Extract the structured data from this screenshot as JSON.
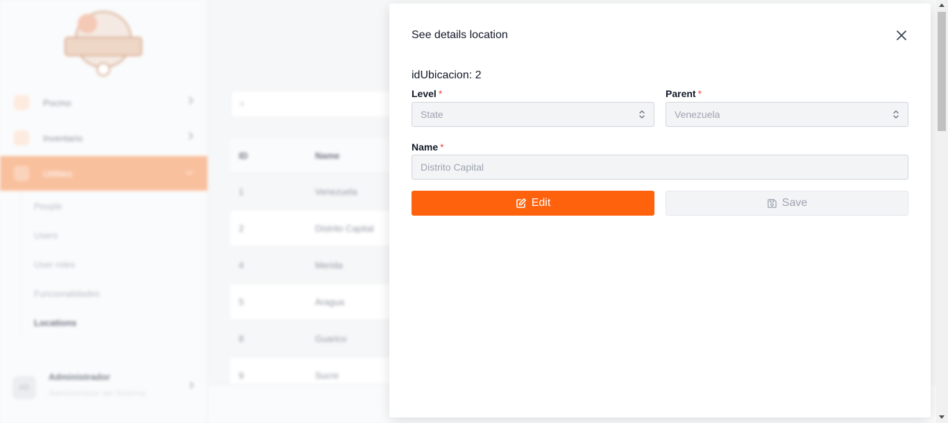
{
  "sidebar": {
    "items": [
      {
        "label": "Pocmo"
      },
      {
        "label": "Inventario"
      },
      {
        "label": "Utilities"
      }
    ],
    "sub_items": [
      {
        "label": "People"
      },
      {
        "label": "Users"
      },
      {
        "label": "User roles"
      },
      {
        "label": "Funcionalidades"
      },
      {
        "label": "Locations"
      }
    ],
    "user": {
      "initials": "AD",
      "name": "Administrador",
      "role": "Administrador del Sistema"
    }
  },
  "main": {
    "search_placeholder": "+",
    "table": {
      "headers": {
        "id": "ID",
        "name": "Name"
      },
      "rows": [
        {
          "id": "1",
          "name": "Venezuela"
        },
        {
          "id": "2",
          "name": "Distrito Capital"
        },
        {
          "id": "4",
          "name": "Merida"
        },
        {
          "id": "5",
          "name": "Aragua"
        },
        {
          "id": "8",
          "name": "Guarico"
        },
        {
          "id": "9",
          "name": "Sucre"
        }
      ]
    }
  },
  "modal": {
    "title": "See details location",
    "id_text": "idUbicacion: 2",
    "level": {
      "label": "Level",
      "required": "*",
      "value": "State"
    },
    "parent": {
      "label": "Parent",
      "required": "*",
      "value": "Venezuela"
    },
    "name": {
      "label": "Name",
      "required": "*",
      "value": "Distrito Capital"
    },
    "edit_label": "Edit",
    "save_label": "Save"
  },
  "colors": {
    "accent": "#ff620c",
    "required": "#ef4444",
    "active_nav": "#f7a878"
  },
  "icons": {
    "close": "close-icon",
    "edit": "edit-icon",
    "save": "save-icon",
    "select": "updown-chevron-icon"
  }
}
